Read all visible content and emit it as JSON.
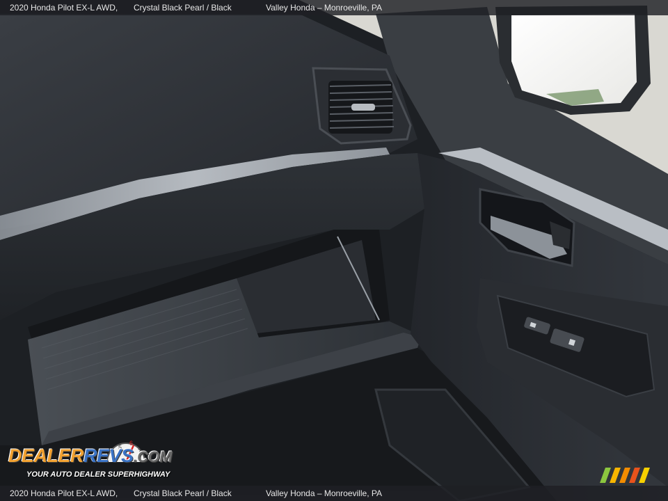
{
  "caption": {
    "title": "2020 Honda Pilot EX-L AWD,",
    "color": "Crystal Black Pearl / Black",
    "dealer": "Valley Honda – Monroeville, PA"
  },
  "watermark": {
    "brand_part1": "DEALER",
    "brand_part2": "REVS",
    "brand_part3": ".COM",
    "tagline": "YOUR AUTO DEALER SUPERHIGHWAY",
    "gauge_numbers": [
      "4",
      "5",
      "6",
      "7"
    ],
    "colors": {
      "orange": "#f0a030",
      "blue": "#3a72c4",
      "gray": "#6a6a6a"
    }
  },
  "corner_badge": {
    "icon": "stripes-logo-icon",
    "colors": [
      "#8cc63f",
      "#f7b500",
      "#f28c00",
      "#e8531c",
      "#f7d000"
    ]
  }
}
